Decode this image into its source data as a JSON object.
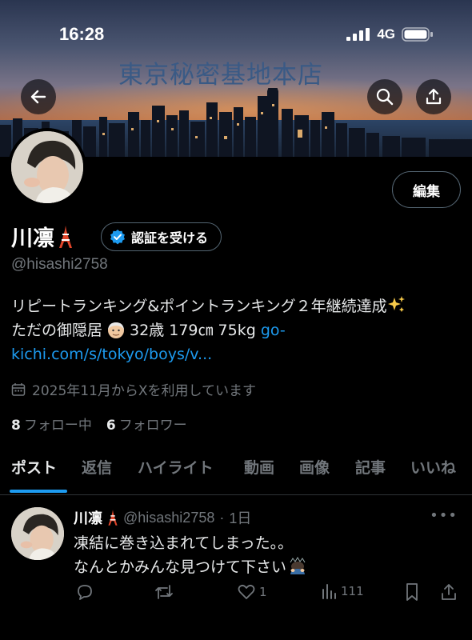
{
  "status": {
    "time": "16:28",
    "network": "4G"
  },
  "banner": {
    "text": "東京秘密基地本店"
  },
  "buttons": {
    "back": "back",
    "search": "search",
    "share": "share",
    "edit": "編集"
  },
  "profile": {
    "name": "川凛",
    "name_emoji": "tokyo-tower",
    "verify_label": "認証を受ける",
    "handle": "@hisashi2758",
    "bio_line1": "リピートランキング&ポイントランキング２年継続達成",
    "bio_line2_prefix": "ただの御隠居",
    "bio_line2_stats": "32歳 179㎝ 75kg ",
    "bio_link": "go-kichi.com/s/tokyo/boys/v...",
    "joined": "2025年11月からXを利用しています",
    "following_count": "8",
    "following_label": "フォロー中",
    "followers_count": "6",
    "followers_label": "フォロワー"
  },
  "tabs": [
    "ポスト",
    "返信",
    "ハイライト",
    "動画",
    "画像",
    "記事",
    "いいね"
  ],
  "post": {
    "name": "川凛",
    "handle": "@hisashi2758",
    "separator": "·",
    "age": "1日",
    "more": "•••",
    "text_line1": "凍結に巻き込まれてしまった。。",
    "text_line2": "なんとかみんな見つけて下さい",
    "likes": "1",
    "views": "111"
  },
  "colors": {
    "accent": "#1d9bf0",
    "muted": "#71767b",
    "background": "#000000"
  }
}
